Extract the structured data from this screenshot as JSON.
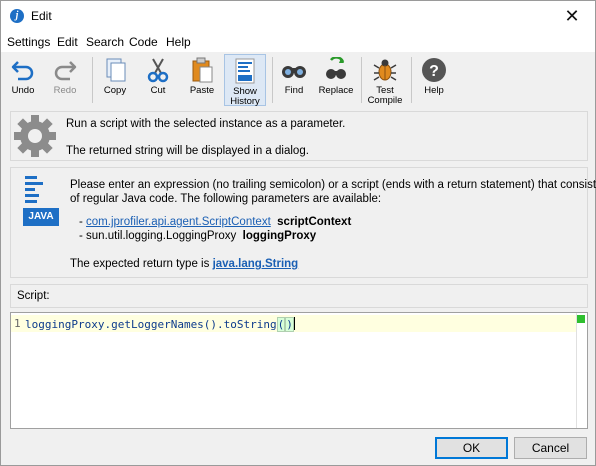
{
  "window": {
    "title": "Edit"
  },
  "menu": [
    "Settings",
    "Edit",
    "Search",
    "Code",
    "Help"
  ],
  "toolbar": {
    "undo": "Undo",
    "redo": "Redo",
    "copy": "Copy",
    "cut": "Cut",
    "paste": "Paste",
    "show_history_1": "Show",
    "show_history_2": "History",
    "find": "Find",
    "replace": "Replace",
    "test_compile_1": "Test",
    "test_compile_2": "Compile",
    "help": "Help"
  },
  "info": {
    "line1": "Run a script with the selected instance as a parameter.",
    "line2": "The returned string will be displayed in a dialog."
  },
  "params": {
    "intro1": "Please enter an expression (no trailing semicolon) or a script (ends with a return statement) that consists",
    "intro2": "of regular Java code. The following parameters are available:",
    "p1_type": "com.jprofiler.api.agent.ScriptContext",
    "p1_name": "scriptContext",
    "p2_type": "sun.util.logging.LoggingProxy",
    "p2_name": "loggingProxy",
    "return_prefix": "The expected return type is",
    "return_type": "java.lang.String",
    "java_icon_label": "JAVA"
  },
  "script": {
    "label": "Script:",
    "line_number": "1",
    "code_before": "loggingProxy.getLoggerNames().toString",
    "code_open": "(",
    "code_close": ")"
  },
  "buttons": {
    "ok": "OK",
    "cancel": "Cancel"
  },
  "colors": {
    "link": "#1a5fb4",
    "active_toolbar": "#dde8f5",
    "status_ok": "#2fbf2f"
  }
}
